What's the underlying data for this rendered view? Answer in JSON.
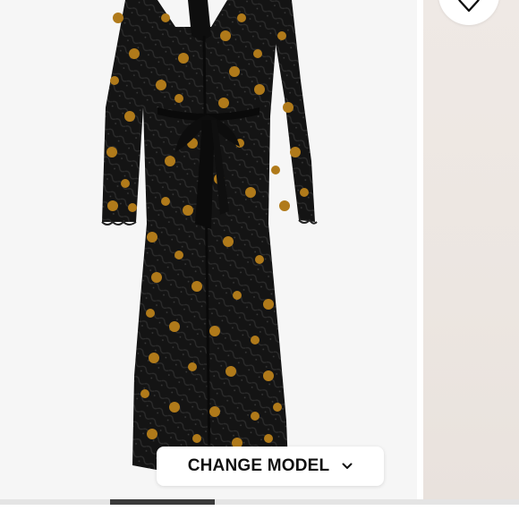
{
  "product_gallery": {
    "main_image": {
      "icon": "dress-illustration",
      "colors": {
        "lace": "#111111",
        "flowers": "#b07a1a",
        "background": "#f6f6f6"
      }
    },
    "favorite_button": {
      "icon": "heart-outline-icon"
    },
    "change_model": {
      "label": "CHANGE MODEL",
      "icon": "chevron-down-icon"
    },
    "carousel": {
      "progress": 0.21
    }
  }
}
